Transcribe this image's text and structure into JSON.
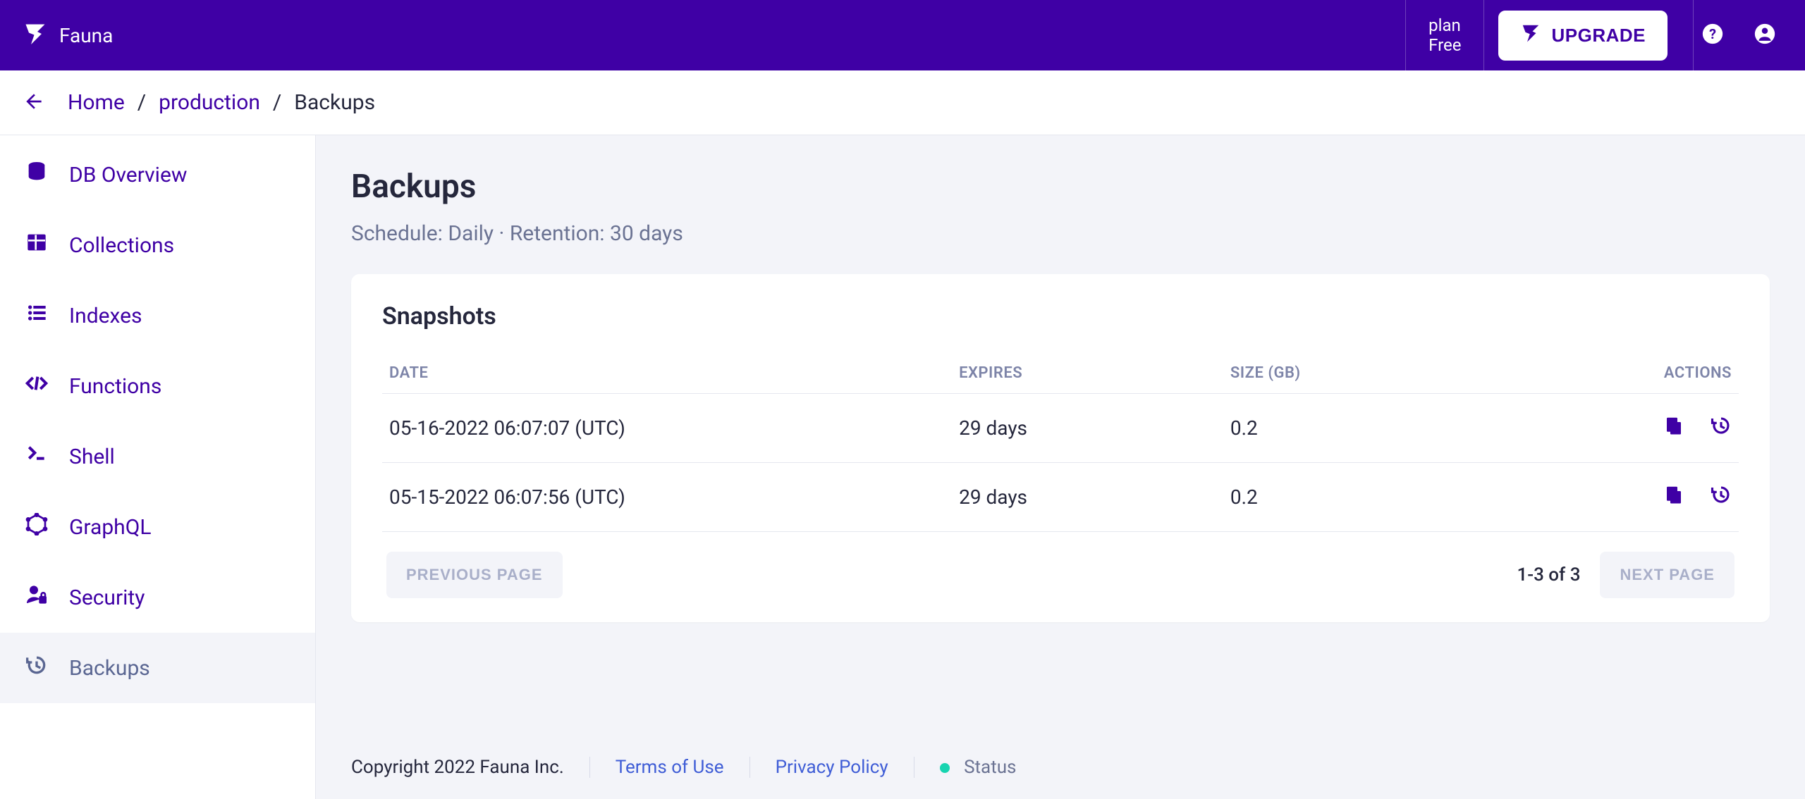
{
  "header": {
    "brand": "Fauna",
    "plan_label": "plan",
    "plan_value": "Free",
    "upgrade": "UPGRADE"
  },
  "breadcrumb": {
    "home": "Home",
    "db": "production",
    "page": "Backups"
  },
  "sidebar": {
    "items": [
      {
        "label": "DB Overview"
      },
      {
        "label": "Collections"
      },
      {
        "label": "Indexes"
      },
      {
        "label": "Functions"
      },
      {
        "label": "Shell"
      },
      {
        "label": "GraphQL"
      },
      {
        "label": "Security"
      },
      {
        "label": "Backups"
      }
    ]
  },
  "page": {
    "title": "Backups",
    "subtitle": "Schedule: Daily · Retention: 30 days"
  },
  "snapshots": {
    "title": "Snapshots",
    "columns": {
      "date": "DATE",
      "expires": "EXPIRES",
      "size": "SIZE (GB)",
      "actions": "ACTIONS"
    },
    "rows": [
      {
        "date": "05-16-2022 06:07:07 (UTC)",
        "expires": "29 days",
        "size": "0.2"
      },
      {
        "date": "05-15-2022 06:07:56 (UTC)",
        "expires": "29 days",
        "size": "0.2"
      }
    ],
    "pager": {
      "prev": "PREVIOUS PAGE",
      "next": "NEXT PAGE",
      "info": "1-3 of 3"
    }
  },
  "footer": {
    "copyright": "Copyright 2022 Fauna Inc.",
    "terms": "Terms of Use",
    "privacy": "Privacy Policy",
    "status": "Status"
  }
}
